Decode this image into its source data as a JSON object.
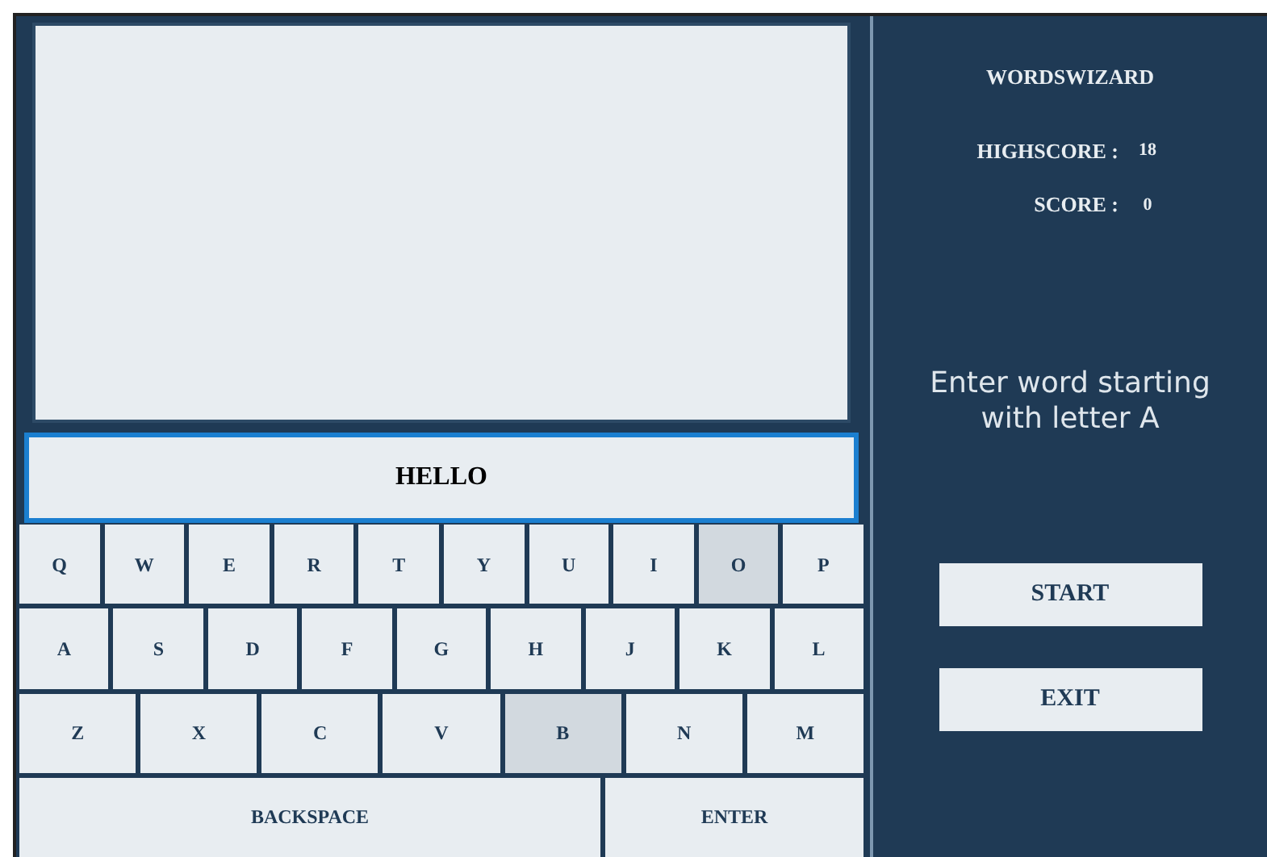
{
  "game_title": "WORDSWIZARD",
  "scores": [
    {
      "label": "HIGHSCORE :",
      "value": "18"
    },
    {
      "label": "SCORE :",
      "value": "0"
    }
  ],
  "input": {
    "value": "HELLO"
  },
  "prompt": "Enter word starting with letter A",
  "keyboard": [
    [
      {
        "label": "Q",
        "highlighted": false
      },
      {
        "label": "W",
        "highlighted": false
      },
      {
        "label": "E",
        "highlighted": false
      },
      {
        "label": "R",
        "highlighted": false
      },
      {
        "label": "T",
        "highlighted": false
      },
      {
        "label": "Y",
        "highlighted": false
      },
      {
        "label": "U",
        "highlighted": false
      },
      {
        "label": "I",
        "highlighted": false
      },
      {
        "label": "O",
        "highlighted": true
      },
      {
        "label": "P",
        "highlighted": false
      }
    ],
    [
      {
        "label": "A",
        "highlighted": false
      },
      {
        "label": "S",
        "highlighted": false
      },
      {
        "label": "D",
        "highlighted": false
      },
      {
        "label": "F",
        "highlighted": false
      },
      {
        "label": "G",
        "highlighted": false
      },
      {
        "label": "H",
        "highlighted": false
      },
      {
        "label": "J",
        "highlighted": false
      },
      {
        "label": "K",
        "highlighted": false
      },
      {
        "label": "L",
        "highlighted": false
      }
    ],
    [
      {
        "label": "Z",
        "highlighted": false
      },
      {
        "label": "X",
        "highlighted": false
      },
      {
        "label": "C",
        "highlighted": false
      },
      {
        "label": "V",
        "highlighted": false
      },
      {
        "label": "B",
        "highlighted": true
      },
      {
        "label": "N",
        "highlighted": false
      },
      {
        "label": "M",
        "highlighted": false
      }
    ],
    [
      {
        "label": "BACKSPACE",
        "highlighted": false
      },
      {
        "label": "ENTER",
        "highlighted": false
      }
    ]
  ],
  "buttons": [
    "START",
    "EXIT"
  ]
}
